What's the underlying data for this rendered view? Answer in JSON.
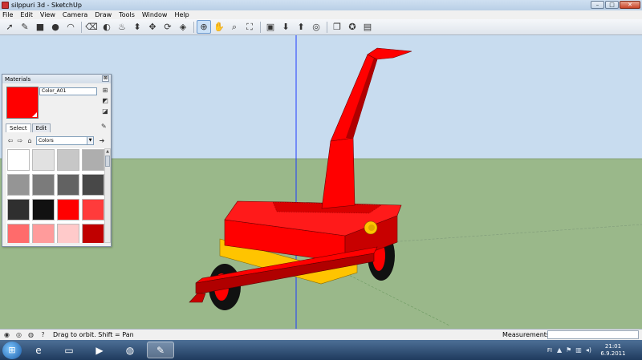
{
  "window": {
    "title": "silppuri 3d - SketchUp",
    "controls": {
      "minimize": "–",
      "maximize": "□",
      "close": "✕"
    }
  },
  "menu": [
    "File",
    "Edit",
    "View",
    "Camera",
    "Draw",
    "Tools",
    "Window",
    "Help"
  ],
  "toolbar": {
    "tools": [
      {
        "name": "select-icon",
        "glyph": "➚"
      },
      {
        "name": "pencil-icon",
        "glyph": "✎"
      },
      {
        "name": "rectangle-icon",
        "glyph": "■"
      },
      {
        "name": "circle-icon",
        "glyph": "●"
      },
      {
        "name": "arc-icon",
        "glyph": "◠"
      },
      {
        "name": "eraser-icon",
        "glyph": "⌫"
      },
      {
        "name": "tape-measure-icon",
        "glyph": "◐"
      },
      {
        "name": "paint-bucket-icon",
        "glyph": "♨"
      },
      {
        "name": "push-pull-icon",
        "glyph": "⬍"
      },
      {
        "name": "move-icon",
        "glyph": "✥"
      },
      {
        "name": "rotate-icon",
        "glyph": "⟳"
      },
      {
        "name": "offset-icon",
        "glyph": "◈"
      },
      {
        "name": "orbit-icon",
        "glyph": "⊕"
      },
      {
        "name": "pan-icon",
        "glyph": "✋"
      },
      {
        "name": "zoom-icon",
        "glyph": "⌕"
      },
      {
        "name": "zoom-extents-icon",
        "glyph": "⛶"
      },
      {
        "name": "previous-view-icon",
        "glyph": "▣"
      },
      {
        "name": "get-models-icon",
        "glyph": "⬇"
      },
      {
        "name": "share-model-icon",
        "glyph": "⬆"
      },
      {
        "name": "google-earth-icon",
        "glyph": "◎"
      },
      {
        "name": "component-icon",
        "glyph": "❒"
      },
      {
        "name": "extension-icon",
        "glyph": "✪"
      },
      {
        "name": "layout-icon",
        "glyph": "▤"
      }
    ]
  },
  "materials": {
    "title": "Materials",
    "close": "⊠",
    "current_name": "Color_A01",
    "current_color": "#ff0000",
    "tabs": [
      "Select",
      "Edit"
    ],
    "library": "Colors",
    "swatches": [
      "#ffffff",
      "#e1e1e1",
      "#c7c7c7",
      "#aeaeae",
      "#959595",
      "#7b7b7b",
      "#626262",
      "#484848",
      "#2f2f2f",
      "#111111",
      "#ff0000",
      "#ff3b3b",
      "#ff6b6b",
      "#ff9b9b",
      "#ffcaca",
      "#c00000"
    ]
  },
  "status": {
    "text": "Drag to orbit.  Shift = Pan",
    "measurements_label": "Measurements",
    "measurements_value": ""
  },
  "taskbar": {
    "apps": [
      {
        "name": "internet-explorer-icon",
        "glyph": "e"
      },
      {
        "name": "file-explorer-icon",
        "glyph": "▭"
      },
      {
        "name": "media-player-icon",
        "glyph": "▶"
      },
      {
        "name": "firefox-icon",
        "glyph": "◍"
      },
      {
        "name": "sketchup-icon",
        "glyph": "✎"
      }
    ],
    "language": "FI",
    "time": "21:01",
    "date": "6.9.2011"
  },
  "colors": {
    "sky": "#c8dcef",
    "ground": "#9ab88a",
    "machine_red": "#ff0000",
    "machine_dark_red": "#b00000",
    "machine_yellow": "#ffc400",
    "axis_blue": "#1e3cff"
  }
}
